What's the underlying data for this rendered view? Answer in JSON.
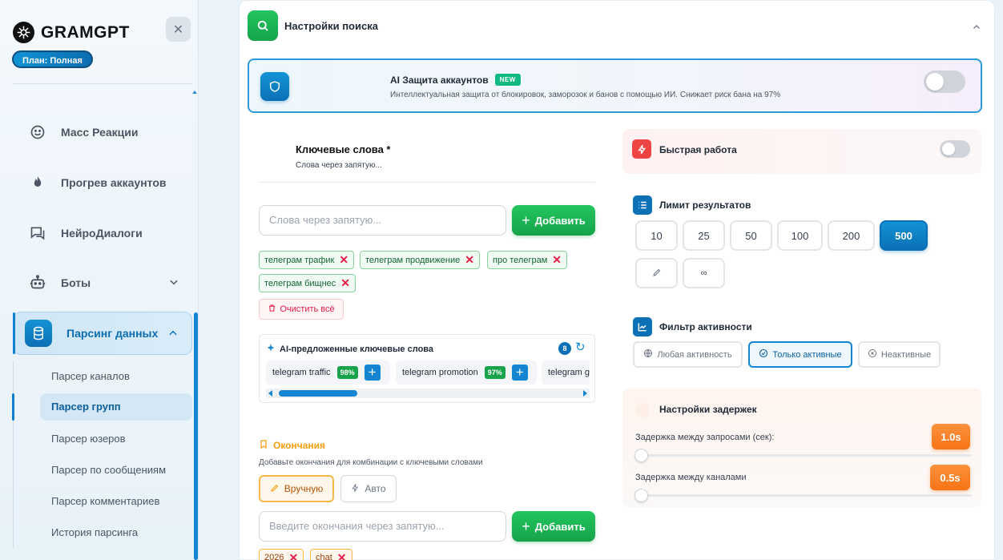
{
  "sidebar": {
    "brand": "GRAMGPT",
    "plan": "План: Полная",
    "nav": [
      {
        "label": "Масс Реакции",
        "icon": "smile-icon"
      },
      {
        "label": "Прогрев аккаунтов",
        "icon": "flame-icon"
      },
      {
        "label": "НейроДиалоги",
        "icon": "chat-icon"
      },
      {
        "label": "Боты",
        "icon": "robot-icon"
      },
      {
        "label": "Парсинг данных",
        "icon": "database-icon"
      }
    ],
    "sub": [
      "Парсер каналов",
      "Парсер групп",
      "Парсер юзеров",
      "Парсер по сообщениям",
      "Парсер комментариев",
      "История парсинга"
    ]
  },
  "section": {
    "title": "Настройки поиска"
  },
  "ai_protection": {
    "title": "AI Защита аккаунтов",
    "badge": "NEW",
    "description": "Интеллектуальная защита от блокировок, заморозок и банов с помощью ИИ. Снижает риск бана на 97%",
    "enabled": false
  },
  "keywords": {
    "title": "Ключевые слова *",
    "subtitle": "Слова через запятую...",
    "placeholder": "Слова через запятую...",
    "add_label": "Добавить",
    "tags": [
      "телеграм трафик",
      "телеграм продвижение",
      "про телеграм",
      "телеграм бищнес"
    ],
    "clear_label": "Очистить всё"
  },
  "ai_suggestions": {
    "title": "AI-предложенные ключевые слова",
    "count": "8",
    "items": [
      {
        "text": "telegram traffic",
        "pct": "98%"
      },
      {
        "text": "telegram promotion",
        "pct": "97%"
      },
      {
        "text": "telegram g"
      }
    ],
    "scroll_position": 0.05
  },
  "endings": {
    "title": "Окончания",
    "subtitle": "Добавьте окончания для комбинации с ключевыми словами",
    "manual_label": "Вручную",
    "auto_label": "Авто",
    "placeholder": "Введите окончания через запятую...",
    "add_label": "Добавить",
    "tags": [
      "2026",
      "chat"
    ]
  },
  "fast_mode": {
    "label": "Быстрая работа",
    "enabled": false
  },
  "limit": {
    "label": "Лимит результатов",
    "options": [
      "10",
      "25",
      "50",
      "100",
      "200",
      "500"
    ],
    "selected": "500",
    "custom_icon": "pencil-icon",
    "infinity": "∞"
  },
  "activity": {
    "label": "Фильтр активности",
    "options": [
      "Любая активность",
      "Только активные",
      "Неактивные"
    ],
    "selected": "Только активные"
  },
  "delays": {
    "title": "Настройки задержек",
    "request_label": "Задержка между запросами (сек):",
    "request_value": "1.0s",
    "channel_label": "Задержка между каналами",
    "channel_value": "0.5s"
  },
  "colors": {
    "accent": "#0b70b6",
    "green": "#16a34a",
    "orange": "#f97316",
    "red": "#ef4444"
  }
}
